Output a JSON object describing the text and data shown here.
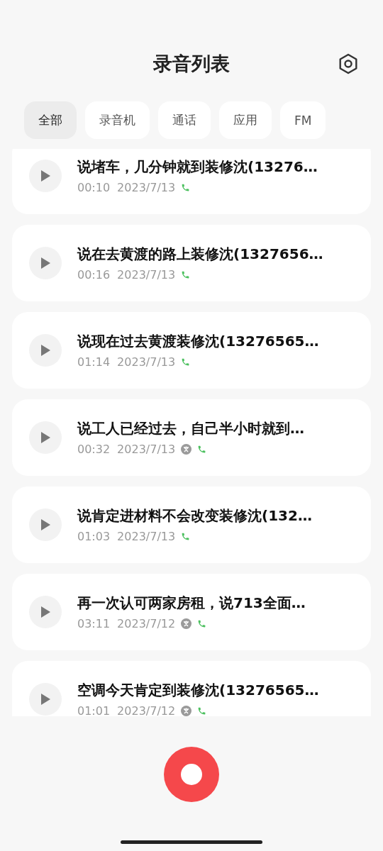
{
  "header": {
    "title": "录音列表"
  },
  "tabs": [
    {
      "label": "全部",
      "selected": true
    },
    {
      "label": "录音机",
      "selected": false
    },
    {
      "label": "通话",
      "selected": false
    },
    {
      "label": "应用",
      "selected": false
    },
    {
      "label": "FM",
      "selected": false
    }
  ],
  "recordings": [
    {
      "title": "说堵车，几分钟就到装修沈(13276…",
      "duration": "00:10",
      "date": "2023/7/13",
      "transcribed": false,
      "call": true
    },
    {
      "title": "说在去黄渡的路上装修沈(1327656…",
      "duration": "00:16",
      "date": "2023/7/13",
      "transcribed": false,
      "call": true
    },
    {
      "title": "说现在过去黄渡装修沈(13276565…",
      "duration": "01:14",
      "date": "2023/7/13",
      "transcribed": false,
      "call": true
    },
    {
      "title": "说工人已经过去，自己半小时就到…",
      "duration": "00:32",
      "date": "2023/7/13",
      "transcribed": true,
      "call": true
    },
    {
      "title": "说肯定进材料不会改变装修沈(132…",
      "duration": "01:03",
      "date": "2023/7/13",
      "transcribed": false,
      "call": true
    },
    {
      "title": "再一次认可两家房租，说713全面…",
      "duration": "03:11",
      "date": "2023/7/12",
      "transcribed": true,
      "call": true
    },
    {
      "title": "空调今天肯定到装修沈(13276565…",
      "duration": "01:01",
      "date": "2023/7/12",
      "transcribed": true,
      "call": true
    }
  ]
}
